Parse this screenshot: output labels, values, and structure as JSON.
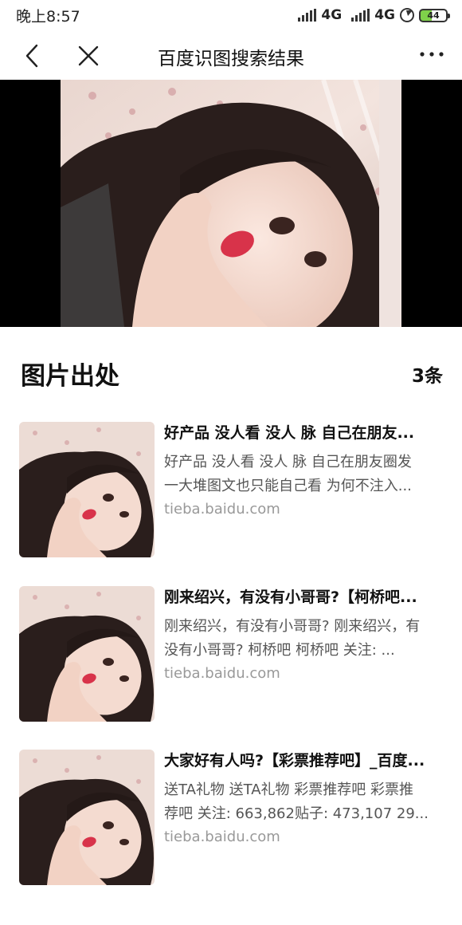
{
  "status_bar": {
    "time": "晚上8:57",
    "network_1": "4G",
    "network_2": "4G",
    "battery": "44"
  },
  "header": {
    "title": "百度识图搜索结果",
    "back_icon": "chevron-left-icon",
    "close_icon": "close-icon",
    "more_icon": "more-dots-icon"
  },
  "hero": {
    "image": "photo-of-girl-with-hand-on-cheek"
  },
  "section": {
    "title": "图片出处",
    "count": "3条"
  },
  "results": [
    {
      "title": "好产品 没人看 没人 脉 自己在朋友...",
      "desc_line_1": "好产品 没人看 没人 脉 自己在朋友圈发",
      "desc_line_2": "一大堆图文也只能自己看 为何不注入...",
      "source": "tieba.baidu.com"
    },
    {
      "title": "刚来绍兴，有没有小哥哥?【柯桥吧...",
      "desc_line_1": "刚来绍兴，有没有小哥哥? 刚来绍兴，有",
      "desc_line_2": "没有小哥哥? 柯桥吧 柯桥吧 关注: ...",
      "source": "tieba.baidu.com"
    },
    {
      "title": "大家好有人吗?【彩票推荐吧】_百度...",
      "desc_line_1": "送TA礼物 送TA礼物 彩票推荐吧 彩票推",
      "desc_line_2": "荐吧 关注: 663,862贴子: 473,107 29...",
      "source": "tieba.baidu.com"
    }
  ]
}
